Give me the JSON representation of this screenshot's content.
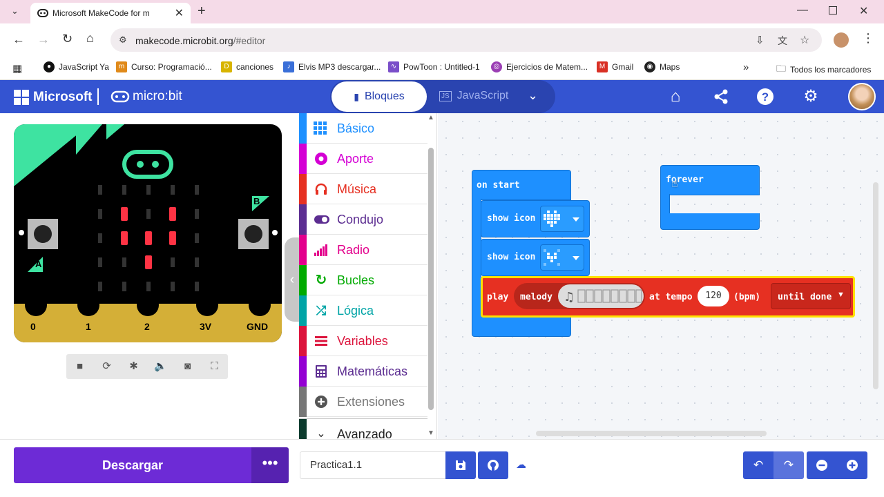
{
  "browser": {
    "tab_title": "Microsoft MakeCode for m",
    "url_host": "makecode.microbit.org",
    "url_path": "/#editor",
    "bookmarks": [
      {
        "label": "JavaScript Ya",
        "icon": "github-icon"
      },
      {
        "label": "Curso: Programació...",
        "icon": "course-icon"
      },
      {
        "label": "canciones",
        "icon": "music-icon"
      },
      {
        "label": "Elvis MP3 descargar...",
        "icon": "mp3-icon"
      },
      {
        "label": "PowToon : Untitled-1",
        "icon": "powtoon-icon"
      },
      {
        "label": "Ejercicios de Matem...",
        "icon": "math-icon"
      },
      {
        "label": "Gmail",
        "icon": "gmail-icon"
      },
      {
        "label": "Maps",
        "icon": "maps-icon"
      }
    ],
    "all_bookmarks": "Todos los marcadores"
  },
  "header": {
    "ms_logo": "Microsoft",
    "microbit_logo": "micro:bit",
    "blocks_tab": "Bloques",
    "js_tab": "JavaScript"
  },
  "simulator": {
    "pins": [
      "0",
      "1",
      "2",
      "3V",
      "GND"
    ],
    "button_a": "A",
    "button_b": "B"
  },
  "toolbox": {
    "categories": [
      {
        "label": "Básico",
        "color": "#1e90ff",
        "icon": "grid-icon"
      },
      {
        "label": "Aporte",
        "color": "#d400d4",
        "icon": "input-icon"
      },
      {
        "label": "Música",
        "color": "#e63022",
        "icon": "headphones-icon"
      },
      {
        "label": "Condujo",
        "color": "#5c2d91",
        "icon": "toggle-icon"
      },
      {
        "label": "Radio",
        "color": "#e3008c",
        "icon": "signal-icon"
      },
      {
        "label": "Bucles",
        "color": "#00aa00",
        "icon": "loop-icon"
      },
      {
        "label": "Lógica",
        "color": "#00a4a6",
        "icon": "shuffle-icon"
      },
      {
        "label": "Variables",
        "color": "#dc143c",
        "icon": "list-icon"
      },
      {
        "label": "Matemáticas",
        "color": "#9400d3",
        "icon": "calculator-icon"
      },
      {
        "label": "Extensiones",
        "color": "#777777",
        "icon": "plus-circle-icon"
      },
      {
        "label": "Avanzado",
        "color": "#222222",
        "icon": "chevron-down-icon"
      }
    ]
  },
  "workspace": {
    "on_start": "on start",
    "show_icon_1": "show icon",
    "show_icon_2": "show icon",
    "play": "play",
    "melody": "melody",
    "at_tempo": "at tempo",
    "tempo_value": "120",
    "bpm": "(bpm)",
    "until_done": "until done",
    "forever": "forever"
  },
  "bottom": {
    "download": "Descargar",
    "more": "•••",
    "project_name": "Practica1.1"
  }
}
